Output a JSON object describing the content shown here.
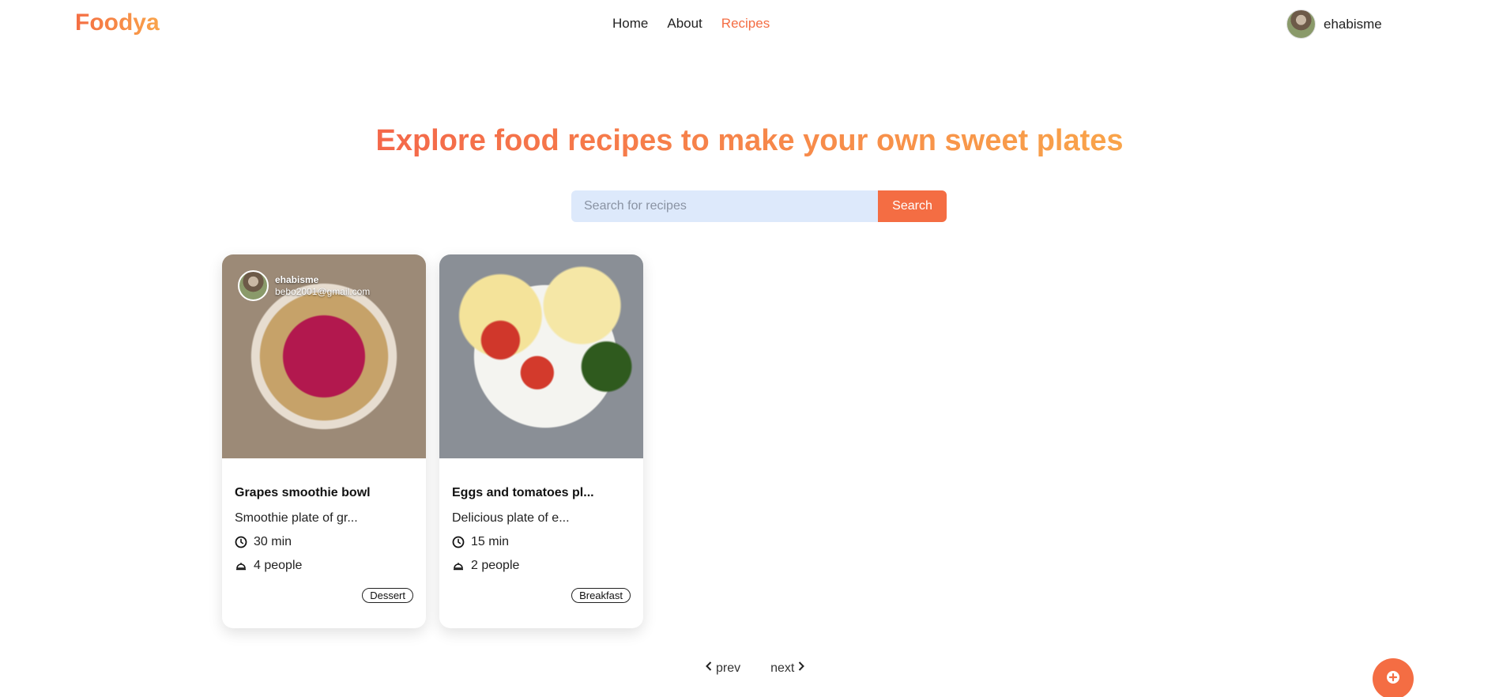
{
  "brand": {
    "logo": "Foodya"
  },
  "nav": {
    "links": [
      {
        "label": "Home"
      },
      {
        "label": "About"
      },
      {
        "label": "Recipes"
      }
    ]
  },
  "user": {
    "name": "ehabisme"
  },
  "hero": {
    "title": "Explore food recipes to make your own sweet plates"
  },
  "search": {
    "placeholder": "Search for recipes",
    "value": "",
    "button_label": "Search"
  },
  "recipes": [
    {
      "author_name": "ehabisme",
      "author_email": "bebo2001@gmail.com",
      "title": "Grapes smoothie bowl",
      "description": "Smoothie plate of gr...",
      "time": "30 min",
      "serves": "4 people",
      "tag": "Dessert"
    },
    {
      "title": "Eggs and tomatoes pl...",
      "description": "Delicious plate of e...",
      "time": "15 min",
      "serves": "2 people",
      "tag": "Breakfast"
    }
  ],
  "pagination": {
    "prev_label": "prev",
    "next_label": "next"
  },
  "colors": {
    "accent": "#f46d43",
    "accent_light": "#f9a44a",
    "search_bg": "#dde9fb"
  },
  "icons": {
    "time": "clock-icon",
    "serves": "dish-cover-icon",
    "prev": "chevron-left-icon",
    "next": "chevron-right-icon",
    "fab": "plus-circle-icon"
  }
}
